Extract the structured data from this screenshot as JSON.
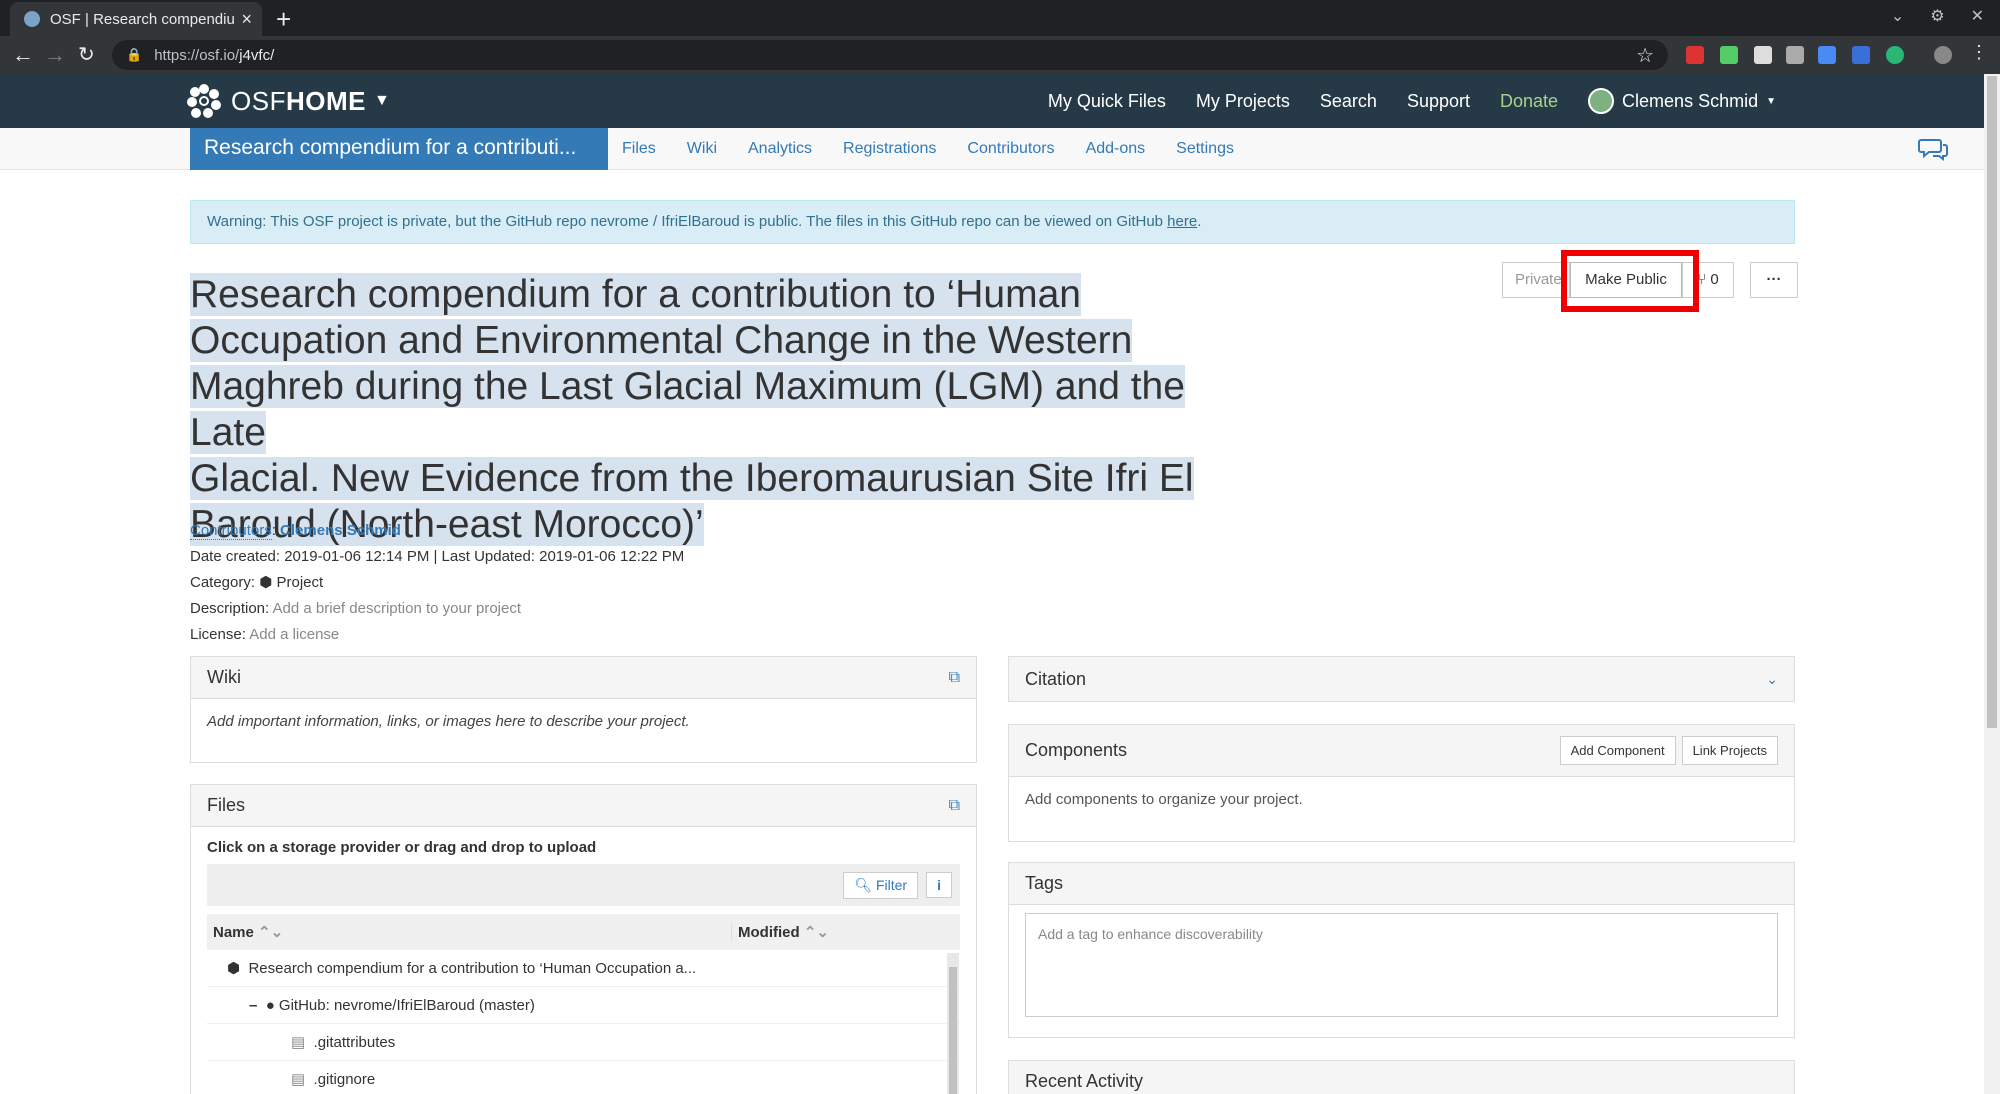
{
  "browser": {
    "tab_title": "OSF | Research compendium f",
    "url_prefix": "https://osf.io/",
    "url_path": "j4vfc/"
  },
  "osf_nav": {
    "brand_osf": "OSF",
    "brand_home": "HOME",
    "links": [
      "My Quick Files",
      "My Projects",
      "Search",
      "Support",
      "Donate"
    ],
    "user": "Clemens Schmid"
  },
  "project_nav": {
    "title": "Research compendium for a contributi...",
    "tabs": [
      "Files",
      "Wiki",
      "Analytics",
      "Registrations",
      "Contributors",
      "Add-ons",
      "Settings"
    ]
  },
  "alert": {
    "text": "Warning: This OSF project is private, but the GitHub repo nevrome / IfriElBaroud is public. The files in this GitHub repo can be viewed on GitHub ",
    "link": "here",
    "end": "."
  },
  "project": {
    "title_lines": [
      "Research compendium for a contribution to ‘Human",
      "Occupation and Environmental Change in the Western",
      "Maghreb during the Last Glacial Maximum (LGM) and the Late",
      "Glacial. New Evidence from the Iberomaurusian Site Ifri El",
      "Baroud (North-east Morocco)’"
    ],
    "private_label": "Private",
    "make_public_label": "Make Public",
    "fork_count": "0",
    "more_label": "···",
    "contributors_label": "Contributors",
    "contributor": "Clemens Schmid",
    "date_line": "Date created: 2019-01-06 12:14 PM | Last Updated: 2019-01-06 12:22 PM",
    "category_label": "Category:",
    "category": "Project",
    "description_label": "Description:",
    "description": "Add a brief description to your project",
    "license_label": "License:",
    "license": "Add a license"
  },
  "wiki": {
    "heading": "Wiki",
    "body": "Add important information, links, or images here to describe your project."
  },
  "files": {
    "heading": "Files",
    "instruction": "Click on a storage provider or drag and drop to upload",
    "filter_label": "Filter",
    "info_label": "i",
    "col_name": "Name",
    "col_modified": "Modified",
    "rows": [
      "Research compendium for a contribution to ‘Human Occupation a...",
      "GitHub: nevrome/IfriElBaroud (master)",
      ".gitattributes",
      ".gitignore"
    ]
  },
  "citation": {
    "heading": "Citation"
  },
  "components": {
    "heading": "Components",
    "add_label": "Add Component",
    "link_label": "Link Projects",
    "body": "Add components to organize your project."
  },
  "tags": {
    "heading": "Tags",
    "placeholder": "Add a tag to enhance discoverability"
  },
  "recent": {
    "heading": "Recent Activity"
  },
  "colors": {
    "nav_bg": "#263947",
    "link": "#337ab7",
    "donate": "#a6d48b",
    "highlight": "#ff0000"
  }
}
